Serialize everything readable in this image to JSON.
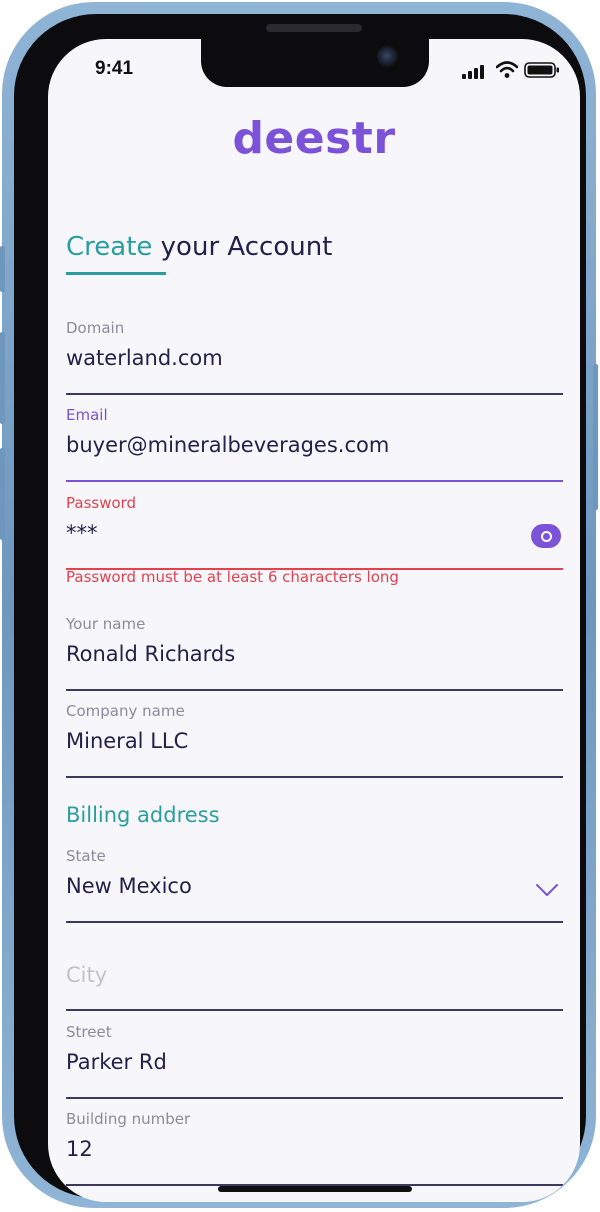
{
  "status_bar": {
    "time": "9:41"
  },
  "brand": {
    "logo_text": "deestr",
    "accent_color": "#7b52d8",
    "teal_color": "#2a9e9f",
    "error_color": "#e0434f"
  },
  "page": {
    "title_accent": "Create",
    "title_rest": " your Account"
  },
  "form": {
    "domain": {
      "label": "Domain",
      "value": "waterland.com"
    },
    "email": {
      "label": "Email",
      "value": "buyer@mineralbeverages.com"
    },
    "password": {
      "label": "Password",
      "value": "***",
      "error": "Password must be at least 6 characters long",
      "toggle_icon": "eye-icon"
    },
    "your_name": {
      "label": "Your name",
      "value": "Ronald Richards"
    },
    "company_name": {
      "label": "Company name",
      "value": "Mineral LLC"
    }
  },
  "billing": {
    "section_title": "Billing address",
    "state": {
      "label": "State",
      "value": "New Mexico",
      "icon": "chevron-down-icon"
    },
    "city": {
      "placeholder": "City"
    },
    "street": {
      "label": "Street",
      "value": "Parker Rd"
    },
    "building_number": {
      "label": "Building number",
      "value": "12"
    }
  }
}
